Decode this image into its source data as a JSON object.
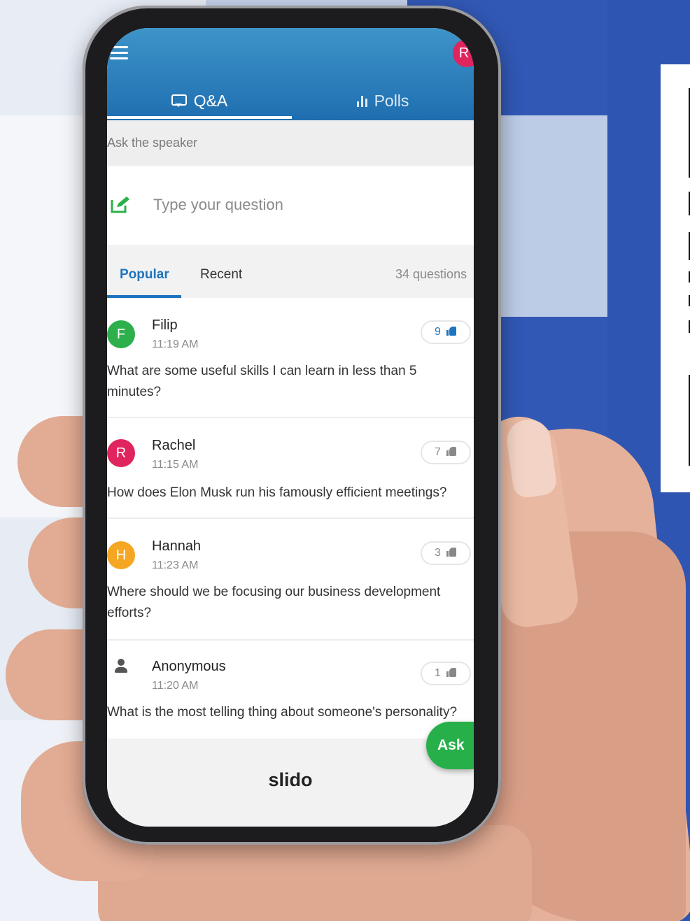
{
  "app": {
    "brand": "slido",
    "user_avatar_initial": "R",
    "colors": {
      "header": "#2a7fbf",
      "accent": "#1e74bd",
      "ask_button": "#27b04a"
    }
  },
  "tabs": [
    {
      "label": "Q&A",
      "icon": "chat-icon",
      "active": true
    },
    {
      "label": "Polls",
      "icon": "bar-chart-icon",
      "active": false
    }
  ],
  "ask": {
    "label": "Ask the speaker",
    "placeholder": "Type your question"
  },
  "filters": {
    "popular": "Popular",
    "recent": "Recent",
    "count": "34 questions"
  },
  "questions": [
    {
      "initial": "F",
      "avatar_color": "#2db04b",
      "name": "Filip",
      "time": "11:19 AM",
      "text": "What are some useful skills I can learn in less than 5 minutes?",
      "likes": "9",
      "liked": true
    },
    {
      "initial": "R",
      "avatar_color": "#e0245e",
      "name": "Rachel",
      "time": "11:15 AM",
      "text": "How does Elon Musk run his famously efficient meetings?",
      "likes": "7",
      "liked": false
    },
    {
      "initial": "H",
      "avatar_color": "#f5a623",
      "name": "Hannah",
      "time": "11:23 AM",
      "text": "Where should we be focusing our business development efforts?",
      "likes": "3",
      "liked": false
    },
    {
      "initial": "",
      "avatar_color": "#ffffff",
      "name": "Anonymous",
      "time": "11:20 AM",
      "text": "What is the most telling thing about someone's personality?",
      "likes": "1",
      "liked": false
    }
  ],
  "actions": {
    "ask_label": "Ask"
  }
}
